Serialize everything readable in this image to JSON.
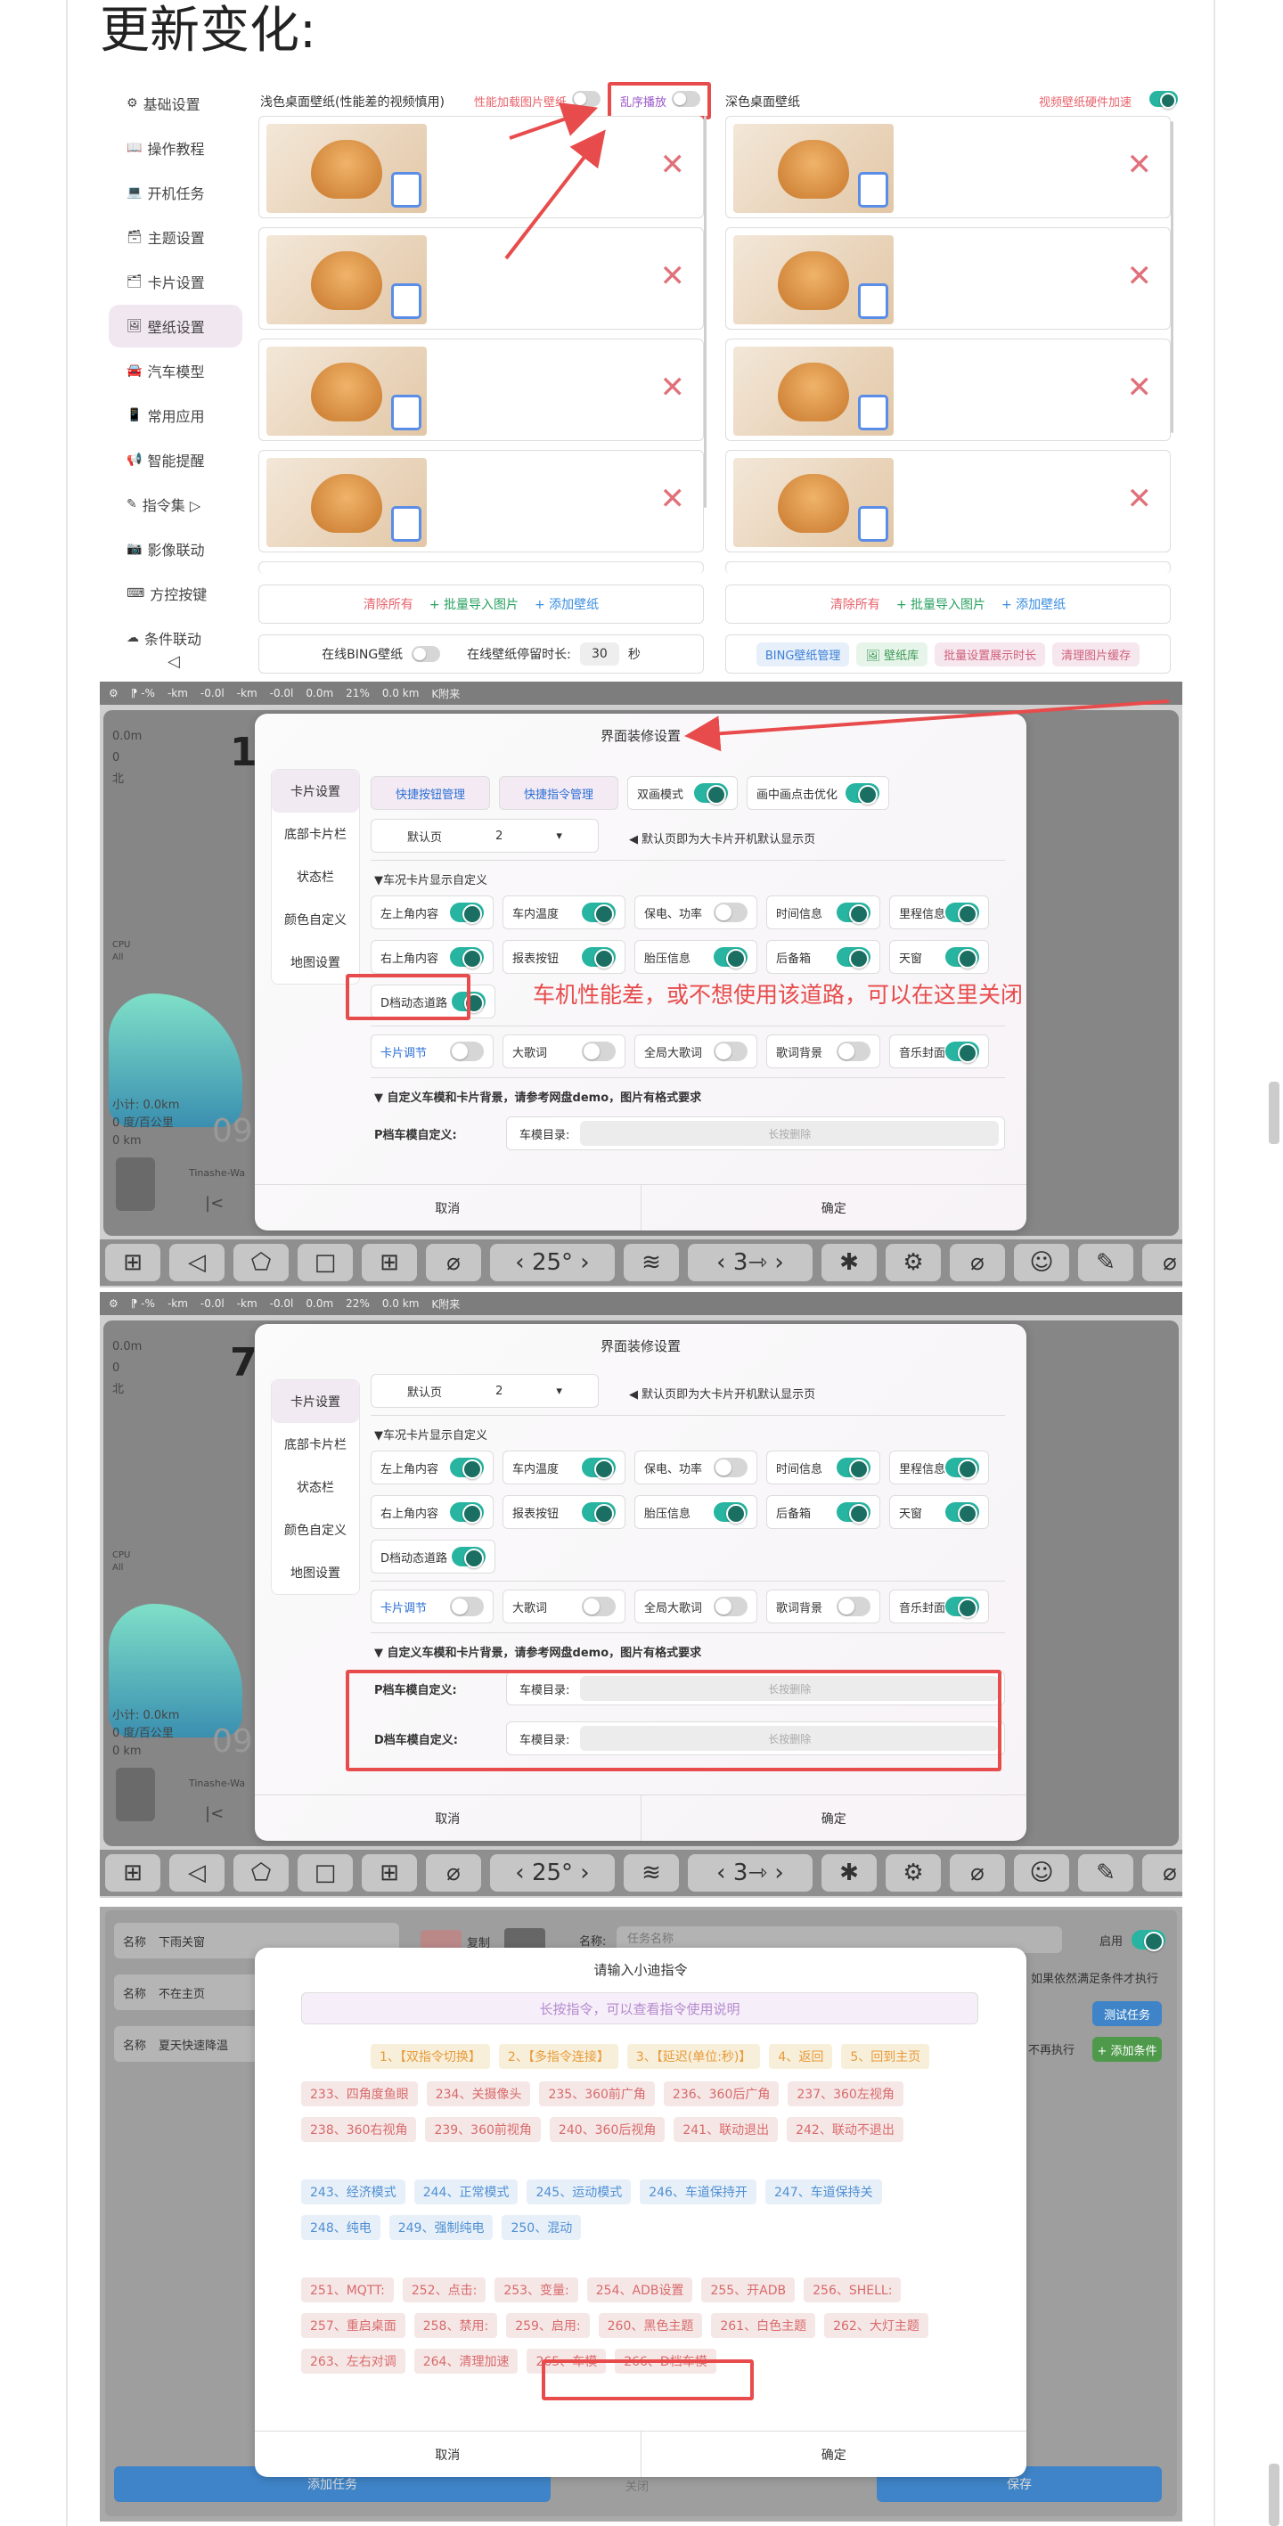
{
  "page_title": "更新变化:",
  "wallpaper": {
    "sidebar": [
      "基础设置",
      "操作教程",
      "开机任务",
      "主题设置",
      "卡片设置",
      "壁纸设置",
      "汽车模型",
      "常用应用",
      "智能提醒",
      "指令集 ▷",
      "影像联动",
      "方控按键",
      "条件联动"
    ],
    "sidebar_icons": [
      "⚙",
      "📖",
      "💻",
      "🗃",
      "🗂",
      "🖼",
      "🚘",
      "📱",
      "📢",
      "✎",
      "📷",
      "⌨",
      "☁"
    ],
    "light_title": "浅色桌面壁纸(性能差的视频慎用)",
    "perf_label": "性能加载图片壁纸",
    "shuffle_label": "乱序播放",
    "dark_title": "深色桌面壁纸",
    "hw_label": "视频壁纸硬件加速",
    "delete_symbol": "✕",
    "left_actions": [
      "清除所有",
      "+ 批量导入图片",
      "+ 添加壁纸"
    ],
    "right_actions": [
      "清除所有",
      "+ 批量导入图片",
      "+ 添加壁纸"
    ],
    "online_bing": "在线BING壁纸",
    "stay_label": "在线壁纸停留时长:",
    "stay_value": "30",
    "stay_unit": "秒",
    "bottom_buttons": [
      "BING壁纸管理",
      "壁纸库",
      "批量设置展示时长",
      "清理图片缓存"
    ],
    "back_symbol": "◁"
  },
  "screen": {
    "status": [
      "⚙",
      "⁋ -%",
      "-km",
      "-0.0l",
      "-km",
      "-0.0l",
      "0.0m",
      "21%",
      "0.0 km",
      "K附来"
    ],
    "status2": [
      "⚙",
      "⁋ -%",
      "-km",
      "-0.0l",
      "-km",
      "-0.0l",
      "0.0m",
      "22%",
      "0.0 km",
      "K附来"
    ],
    "left_info": [
      "0.0m",
      "0",
      "北"
    ],
    "big_num": "1",
    "big_num2": "7",
    "cpu": "CPU",
    "all": "All",
    "trip": "小计: 0.0km",
    "consume": "0 度/百公里",
    "odo": "0 km",
    "media": "Tinashe-Wa",
    "prev": "|<",
    "ghost": "09",
    "bottom_bar": [
      "⊞",
      "◁",
      "⬠",
      "□",
      "⊞",
      "⌀",
      "‹ 25° ›",
      "≋",
      "‹ 3⇾ ›",
      "✱",
      "⚙",
      "⌀",
      "☺",
      "✎",
      "⌀"
    ]
  },
  "settings_dialog": {
    "title": "界面装修设置",
    "tabs": [
      "卡片设置",
      "底部卡片栏",
      "状态栏",
      "颜色自定义",
      "地图设置"
    ],
    "quick_btn": "快捷按钮管理",
    "quick_cmd": "快捷指令管理",
    "dual": "双画模式",
    "click_opt": "画中画点击优化",
    "default_page": "默认页",
    "default_val": "2",
    "default_hint": "◀ 默认页即为大卡片开机默认显示页",
    "section1": "▼车况卡片显示自定义",
    "opts_row1": [
      "左上角内容",
      "车内温度",
      "保电、功率",
      "时间信息",
      "里程信息"
    ],
    "opts_row2": [
      "右上角内容",
      "报表按钮",
      "胎压信息",
      "后备箱",
      "天窗"
    ],
    "d_road": "D档动态道路",
    "card_adjust": "卡片调节",
    "opts_row3": [
      "大歌词",
      "全局大歌词",
      "歌词背景",
      "音乐封面"
    ],
    "section2": "▼ 自定义车模和卡片背景，请参考网盘demo，图片有格式要求",
    "p_model": "P档车模自定义:",
    "d_model": "D档车模自定义:",
    "model_dir": "车模目录:",
    "long_press": "长按删除",
    "cancel": "取消",
    "ok": "确定",
    "annotation": "车机性能差，或不想使用该道路，可以在这里关闭"
  },
  "command_dialog": {
    "bg_name_label": "名称",
    "bg_names": [
      "下雨关窗",
      "不在主页",
      "夏天快速降温"
    ],
    "bg_copy": "复制",
    "bg_task_name": "名称:",
    "bg_task_placeholder": "任务名称",
    "bg_enable": "启用",
    "bg_hint": "，如果依然满足条件才执行",
    "bg_test": "测试任务",
    "bg_no_exec": "不再执行",
    "bg_add_cond": "+ 添加条件",
    "bg_add_task": "添加任务",
    "bg_close": "关闭",
    "bg_save": "保存",
    "title": "请输入小迪指令",
    "hint": "长按指令，可以查看指令使用说明",
    "top_chips": [
      "1、【双指令切换】",
      "2、【多指令连接】",
      "3、【延迟(单位:秒)】",
      "4、返回",
      "5、回到主页"
    ],
    "red_chips1": [
      "233、四角度鱼眼",
      "234、关摄像头",
      "235、360前广角",
      "236、360后广角",
      "237、360左视角"
    ],
    "red_chips2": [
      "238、360右视角",
      "239、360前视角",
      "240、360后视角",
      "241、联动退出",
      "242、联动不退出"
    ],
    "blue_chips1": [
      "243、经济模式",
      "244、正常模式",
      "245、运动模式",
      "246、车道保持开",
      "247、车道保持关"
    ],
    "blue_chips2": [
      "248、纯电",
      "249、强制纯电",
      "250、混动"
    ],
    "red_chips3": [
      "251、MQTT:",
      "252、点击:",
      "253、变量:",
      "254、ADB设置",
      "255、开ADB",
      "256、SHELL:"
    ],
    "red_chips4": [
      "257、重启桌面",
      "258、禁用:",
      "259、启用:",
      "260、黑色主题",
      "261、白色主题",
      "262、大灯主题"
    ],
    "red_chips5": [
      "263、左右对调",
      "264、清理加速",
      "265、车模",
      "266、D档车模"
    ],
    "cancel": "取消",
    "ok": "确定"
  },
  "colors": {
    "accent": "#e84b4b",
    "toggle_on": "#27b4a0"
  }
}
